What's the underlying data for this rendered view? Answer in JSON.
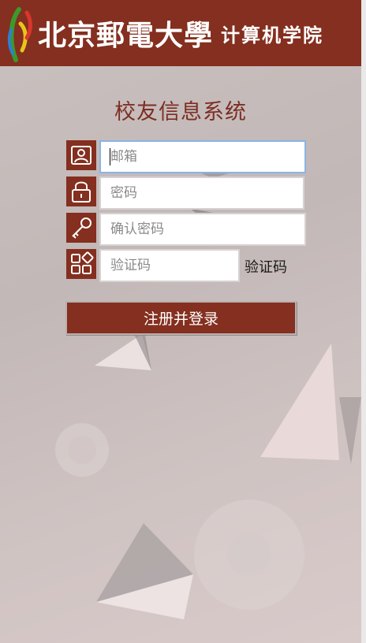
{
  "header": {
    "logo_main": "北京郵電大學",
    "logo_sub": "计算机学院"
  },
  "page_title": "校友信息系统",
  "form": {
    "email_placeholder": "邮箱",
    "password_placeholder": "密码",
    "confirm_password_placeholder": "确认密码",
    "captcha_placeholder": "验证码",
    "captcha_label": "验证码",
    "submit_label": "注册并登录"
  },
  "icons": {
    "email": "user-card-icon",
    "password": "lock-icon",
    "confirm_password": "key-icon",
    "captcha": "apps-grid-icon"
  },
  "colors": {
    "brand": "#842f1f",
    "title": "#7d2e23",
    "focus_border": "#8ab3e6"
  }
}
